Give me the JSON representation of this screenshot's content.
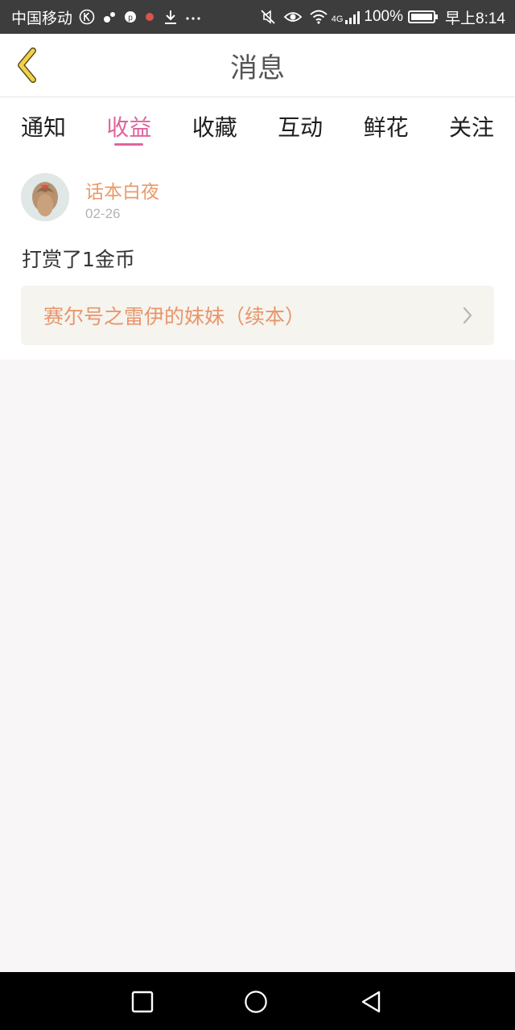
{
  "status_bar": {
    "carrier": "中国移动",
    "battery": "100%",
    "network": "4G",
    "time": "早上8:14",
    "icons": [
      "k-icon",
      "app-icon",
      "p-icon",
      "app-icon",
      "download-icon",
      "more-icon",
      "mute-icon",
      "eye-icon",
      "wifi-icon",
      "signal-icon",
      "battery-icon"
    ]
  },
  "header": {
    "title": "消息",
    "back_icon": "chevron-left-icon"
  },
  "tabs": [
    {
      "label": "通知",
      "active": false
    },
    {
      "label": "收益",
      "active": true
    },
    {
      "label": "收藏",
      "active": false
    },
    {
      "label": "互动",
      "active": false
    },
    {
      "label": "鲜花",
      "active": false
    },
    {
      "label": "关注",
      "active": false
    }
  ],
  "message": {
    "username": "话本白夜",
    "date": "02-26",
    "text": "打赏了1金币",
    "book_title": "赛尔号之雷伊的妹妹（续本）"
  },
  "colors": {
    "accent": "#e0649e",
    "username": "#e99a6a",
    "book_title": "#e9956a",
    "back_icon": "#e8c84a"
  },
  "nav_bar": {
    "icons": [
      "square-icon",
      "circle-icon",
      "triangle-back-icon"
    ]
  }
}
